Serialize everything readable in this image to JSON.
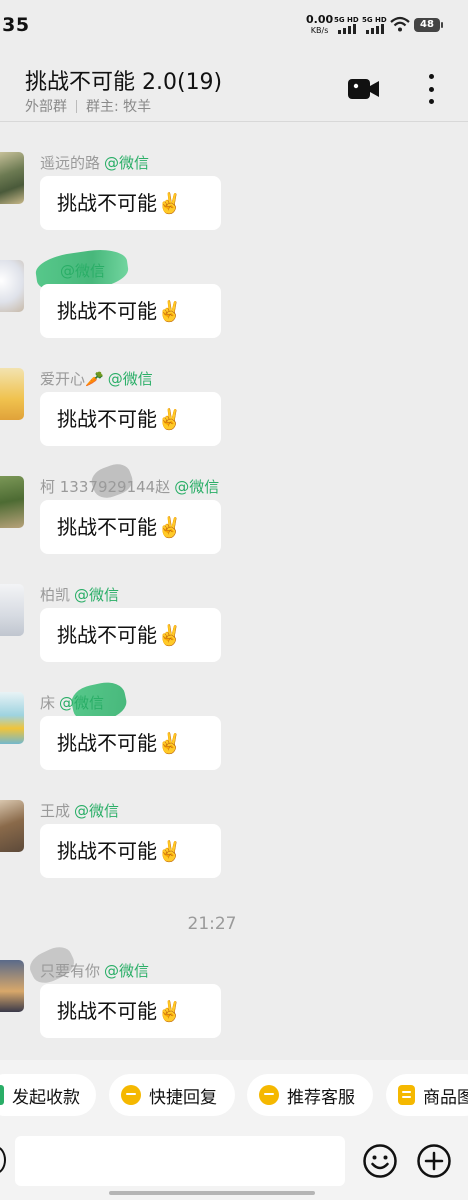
{
  "status": {
    "time": ":35",
    "net_speed": "0.00",
    "net_unit": "KB/s",
    "sim1_label": "5G HD",
    "sim2_label": "5G HD",
    "battery": "48"
  },
  "header": {
    "title": "挑战不可能 2.0(19)",
    "subtitle_left": "外部群",
    "subtitle_right": "群主: 牧羊",
    "video_icon": "video-camera-icon",
    "more_icon": "more-vertical-icon"
  },
  "messages": [
    {
      "sender": "遥远的路",
      "tag": "@微信",
      "text": "挑战不可能✌️"
    },
    {
      "sender": "",
      "tag": "@微信",
      "text": "挑战不可能✌️"
    },
    {
      "sender": "爱开心🥕",
      "tag": "@微信",
      "text": "挑战不可能✌️"
    },
    {
      "sender": "柯 1337929144赵",
      "tag": "@微信",
      "text": "挑战不可能✌️"
    },
    {
      "sender": "柏凯",
      "tag": "@微信",
      "text": "挑战不可能✌️"
    },
    {
      "sender": "床",
      "tag": "@微信",
      "text": "挑战不可能✌️"
    },
    {
      "sender": "王成",
      "tag": "@微信",
      "text": "挑战不可能✌️"
    },
    {
      "sender": "只要有你",
      "tag": "@微信",
      "text": "挑战不可能✌️"
    }
  ],
  "timestamp": "21:27",
  "quick_actions": [
    {
      "label": "发起收款",
      "icon": "payment-icon"
    },
    {
      "label": "快捷回复",
      "icon": "quick-reply-icon"
    },
    {
      "label": "推荐客服",
      "icon": "customer-service-icon"
    },
    {
      "label": "商品图",
      "icon": "product-icon"
    }
  ],
  "input": {
    "placeholder": "",
    "value": ""
  },
  "colors": {
    "accent": "#2aae67",
    "background": "#ededed",
    "quick_icon": "#f5b800"
  }
}
